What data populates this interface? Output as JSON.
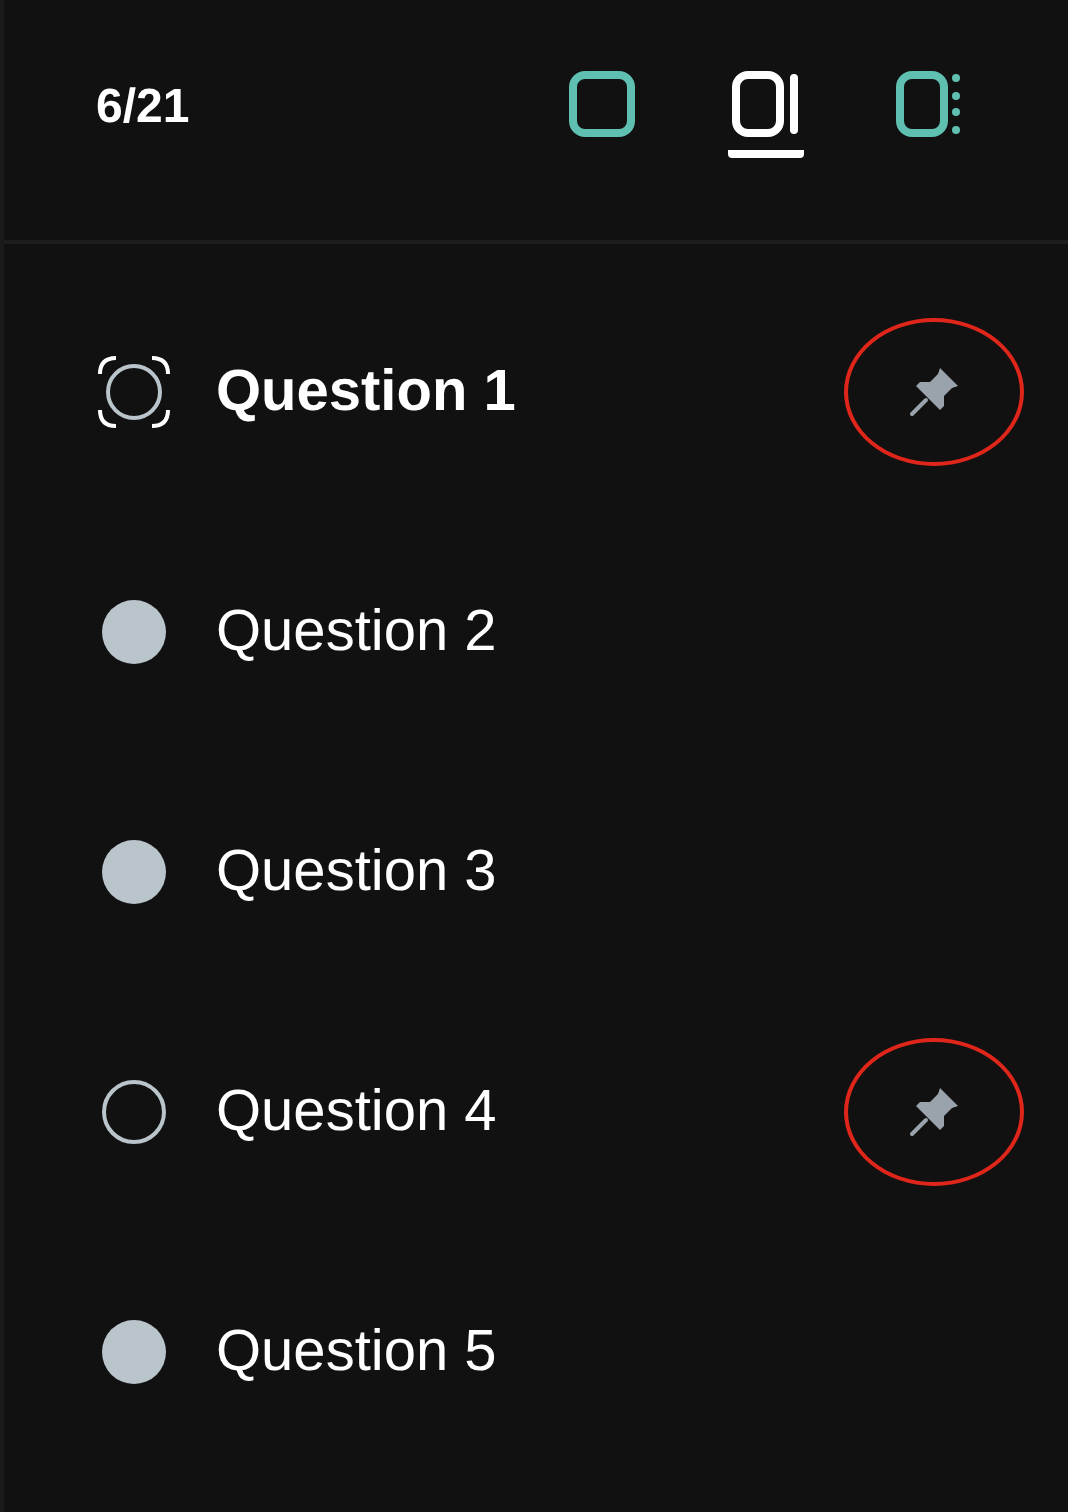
{
  "header": {
    "counter": "6/21",
    "views": [
      {
        "kind": "single",
        "selected": false
      },
      {
        "kind": "split",
        "selected": true
      },
      {
        "kind": "sidebar",
        "selected": false
      }
    ]
  },
  "questions": [
    {
      "label": "Question 1",
      "kind": "current",
      "pinned": true
    },
    {
      "label": "Question 2",
      "kind": "answered",
      "pinned": false
    },
    {
      "label": "Question 3",
      "kind": "answered",
      "pinned": false
    },
    {
      "label": "Question 4",
      "kind": "unanswered",
      "pinned": true
    },
    {
      "label": "Question 5",
      "kind": "answered",
      "pinned": false
    }
  ]
}
